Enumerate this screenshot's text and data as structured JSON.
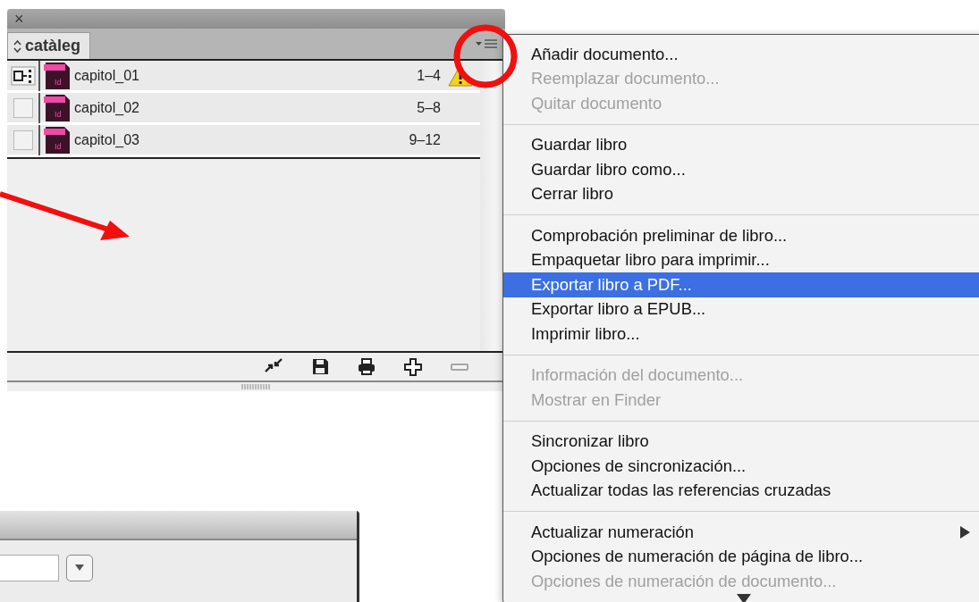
{
  "panel": {
    "close": "×",
    "tab": {
      "label": "catàleg",
      "selected": true
    },
    "documents": [
      {
        "name": "capitol_01",
        "file_badge": "Id",
        "pages": "1–4",
        "style_source": true,
        "warning": true
      },
      {
        "name": "capitol_02",
        "file_badge": "Id",
        "pages": "5–8",
        "style_source": false,
        "warning": false
      },
      {
        "name": "capitol_03",
        "file_badge": "Id",
        "pages": "9–12",
        "style_source": false,
        "warning": false
      }
    ],
    "toolbar": [
      {
        "kind": "sync",
        "disabled": false
      },
      {
        "kind": "save",
        "disabled": false
      },
      {
        "kind": "print",
        "disabled": false
      },
      {
        "kind": "add",
        "disabled": false
      },
      {
        "kind": "remove",
        "disabled": true
      }
    ]
  },
  "menu": {
    "items": [
      {
        "kind": "item",
        "label": "Añadir documento...",
        "disabled": false,
        "selected": false
      },
      {
        "kind": "item",
        "label": "Reemplazar documento...",
        "disabled": true,
        "selected": false
      },
      {
        "kind": "item",
        "label": "Quitar documento",
        "disabled": true,
        "selected": false
      },
      {
        "kind": "separator"
      },
      {
        "kind": "item",
        "label": "Guardar libro",
        "disabled": false,
        "selected": false
      },
      {
        "kind": "item",
        "label": "Guardar libro como...",
        "disabled": false,
        "selected": false
      },
      {
        "kind": "item",
        "label": "Cerrar libro",
        "disabled": false,
        "selected": false
      },
      {
        "kind": "separator"
      },
      {
        "kind": "item",
        "label": "Comprobación preliminar de libro...",
        "disabled": false,
        "selected": false
      },
      {
        "kind": "item",
        "label": "Empaquetar libro para imprimir...",
        "disabled": false,
        "selected": false
      },
      {
        "kind": "item",
        "label": "Exportar libro a PDF...",
        "disabled": false,
        "selected": true
      },
      {
        "kind": "item",
        "label": "Exportar libro a EPUB...",
        "disabled": false,
        "selected": false
      },
      {
        "kind": "item",
        "label": "Imprimir libro...",
        "disabled": false,
        "selected": false
      },
      {
        "kind": "separator"
      },
      {
        "kind": "item",
        "label": "Información del documento...",
        "disabled": true,
        "selected": false
      },
      {
        "kind": "item",
        "label": "Mostrar en Finder",
        "disabled": true,
        "selected": false
      },
      {
        "kind": "separator"
      },
      {
        "kind": "item",
        "label": "Sincronizar libro",
        "disabled": false,
        "selected": false
      },
      {
        "kind": "item",
        "label": "Opciones de sincronización...",
        "disabled": false,
        "selected": false
      },
      {
        "kind": "item",
        "label": "Actualizar todas las referencias cruzadas",
        "disabled": false,
        "selected": false
      },
      {
        "kind": "separator"
      },
      {
        "kind": "submenu",
        "label": "Actualizar numeración",
        "disabled": false,
        "selected": false
      },
      {
        "kind": "item",
        "label": "Opciones de numeración de página de libro...",
        "disabled": false,
        "selected": false
      },
      {
        "kind": "item",
        "label": "Opciones de numeración de documento...",
        "disabled": true,
        "selected": false
      }
    ]
  }
}
